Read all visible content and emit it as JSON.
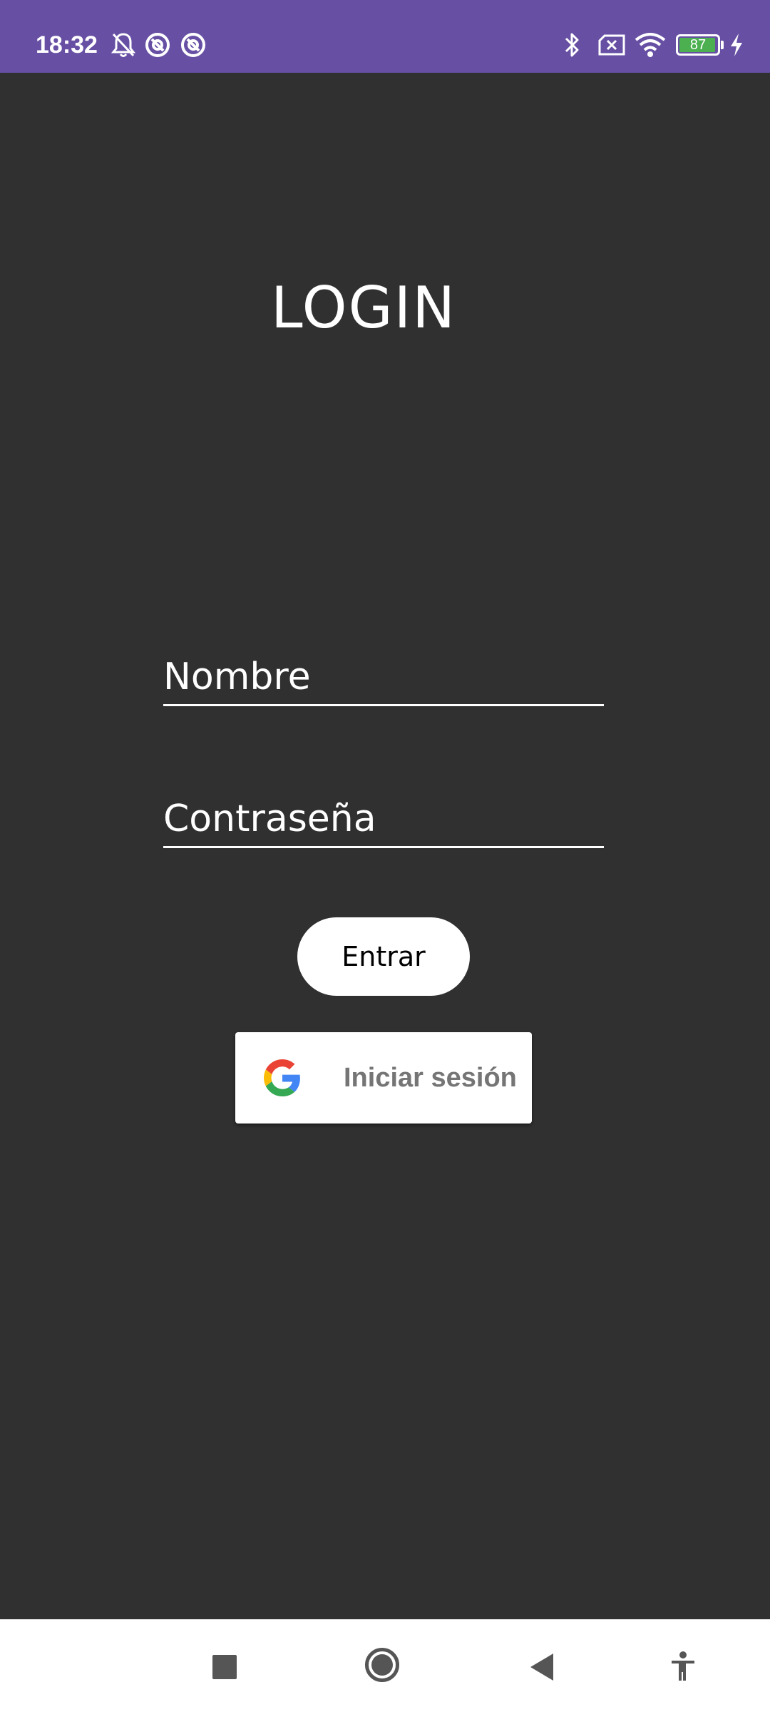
{
  "status_bar": {
    "time": "18:32",
    "battery_level": "87",
    "icons_left": [
      "bell-off-icon",
      "app-notification-icon",
      "app-notification-icon"
    ],
    "icons_right": [
      "bluetooth-icon",
      "no-sim-icon",
      "wifi-icon",
      "battery-icon",
      "charging-icon"
    ]
  },
  "screen": {
    "title": "LOGIN",
    "username_placeholder": "Nombre",
    "password_placeholder": "Contraseña",
    "enter_label": "Entrar",
    "google_signin_label": "Iniciar sesión"
  },
  "nav_bar": {
    "buttons": [
      "recents-square-icon",
      "home-circle-icon",
      "back-triangle-icon",
      "accessibility-icon"
    ]
  },
  "colors": {
    "status_bar": "#6750a4",
    "background": "#303030",
    "google_label": "#757575"
  }
}
